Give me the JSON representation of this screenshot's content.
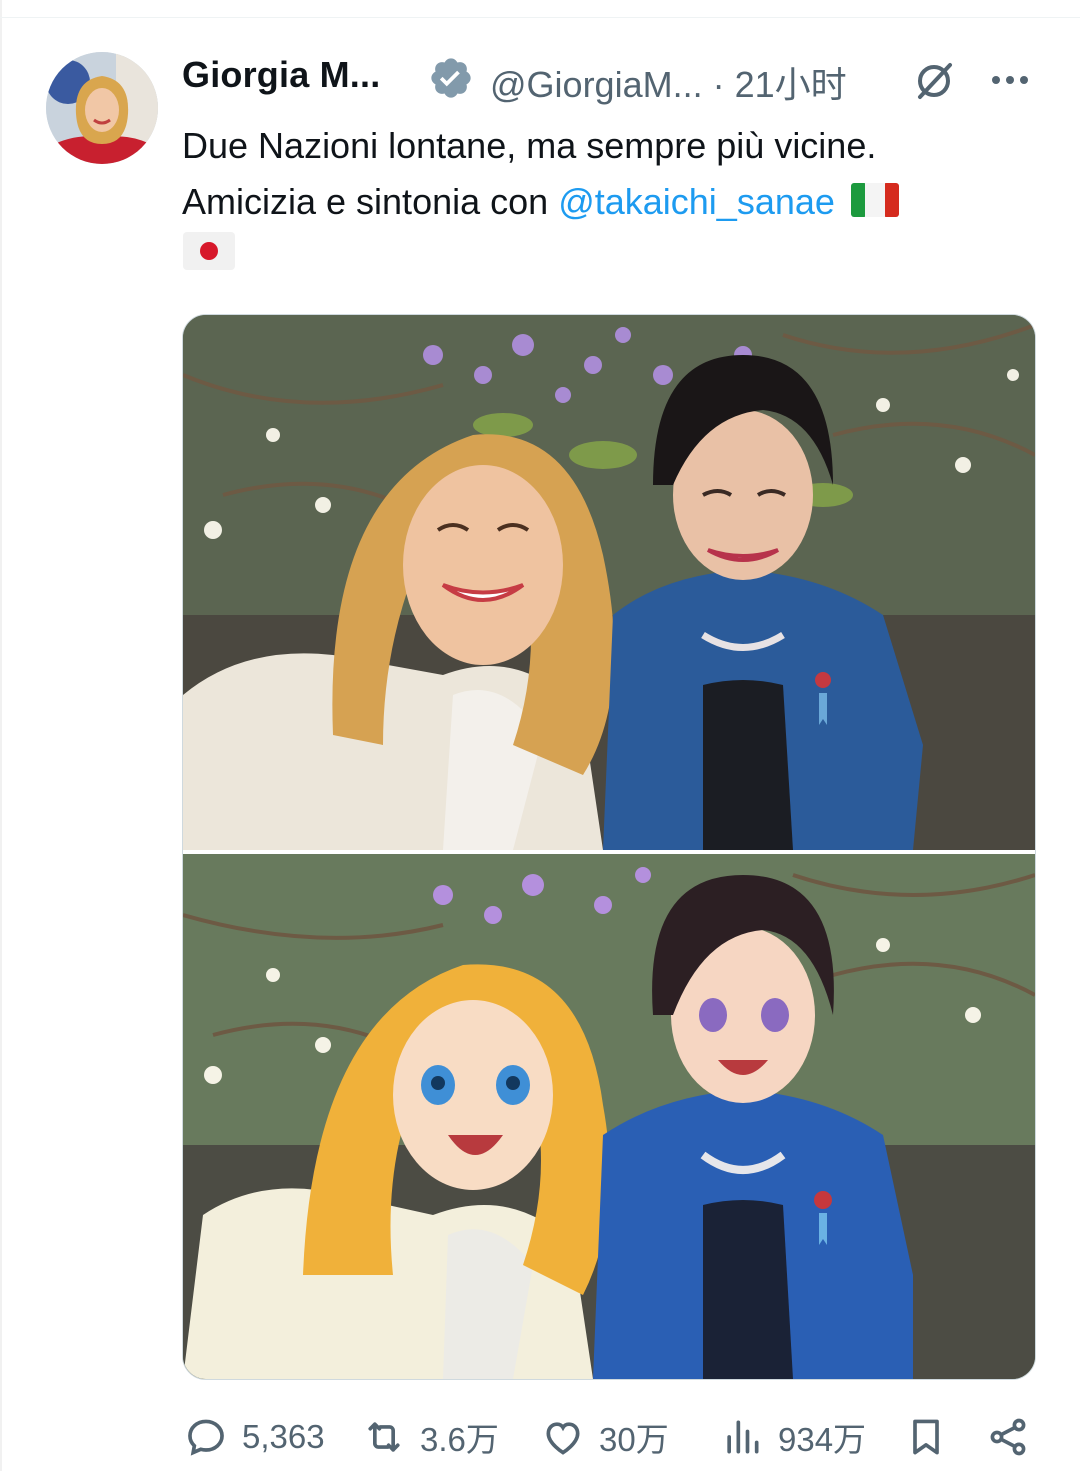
{
  "tweet": {
    "author_name": "Giorgia M...",
    "handle": "@GiorgiaM...",
    "time": "· 21小时",
    "text_line1": "Due Nazioni lontane, ma sempre più vicine.",
    "text_line2_prefix": "Amicizia e sintonia con",
    "mention": "@takaichi_sanae",
    "icons": {
      "verified": "verified-badge-icon",
      "grok": "grok-icon",
      "more": "more-icon",
      "flag_it": "flag-italy-icon",
      "flag_jp": "flag-japan-icon"
    }
  },
  "media": {
    "top_photo": "photo",
    "bottom_photo": "anime illustration"
  },
  "actions": {
    "replies": "5,363",
    "retweets": "3.6万",
    "likes": "30万",
    "views": "934万"
  },
  "colors": {
    "text": "#0f1419",
    "muted": "#536471",
    "link": "#1d9bf0",
    "verified": "#829aab"
  }
}
